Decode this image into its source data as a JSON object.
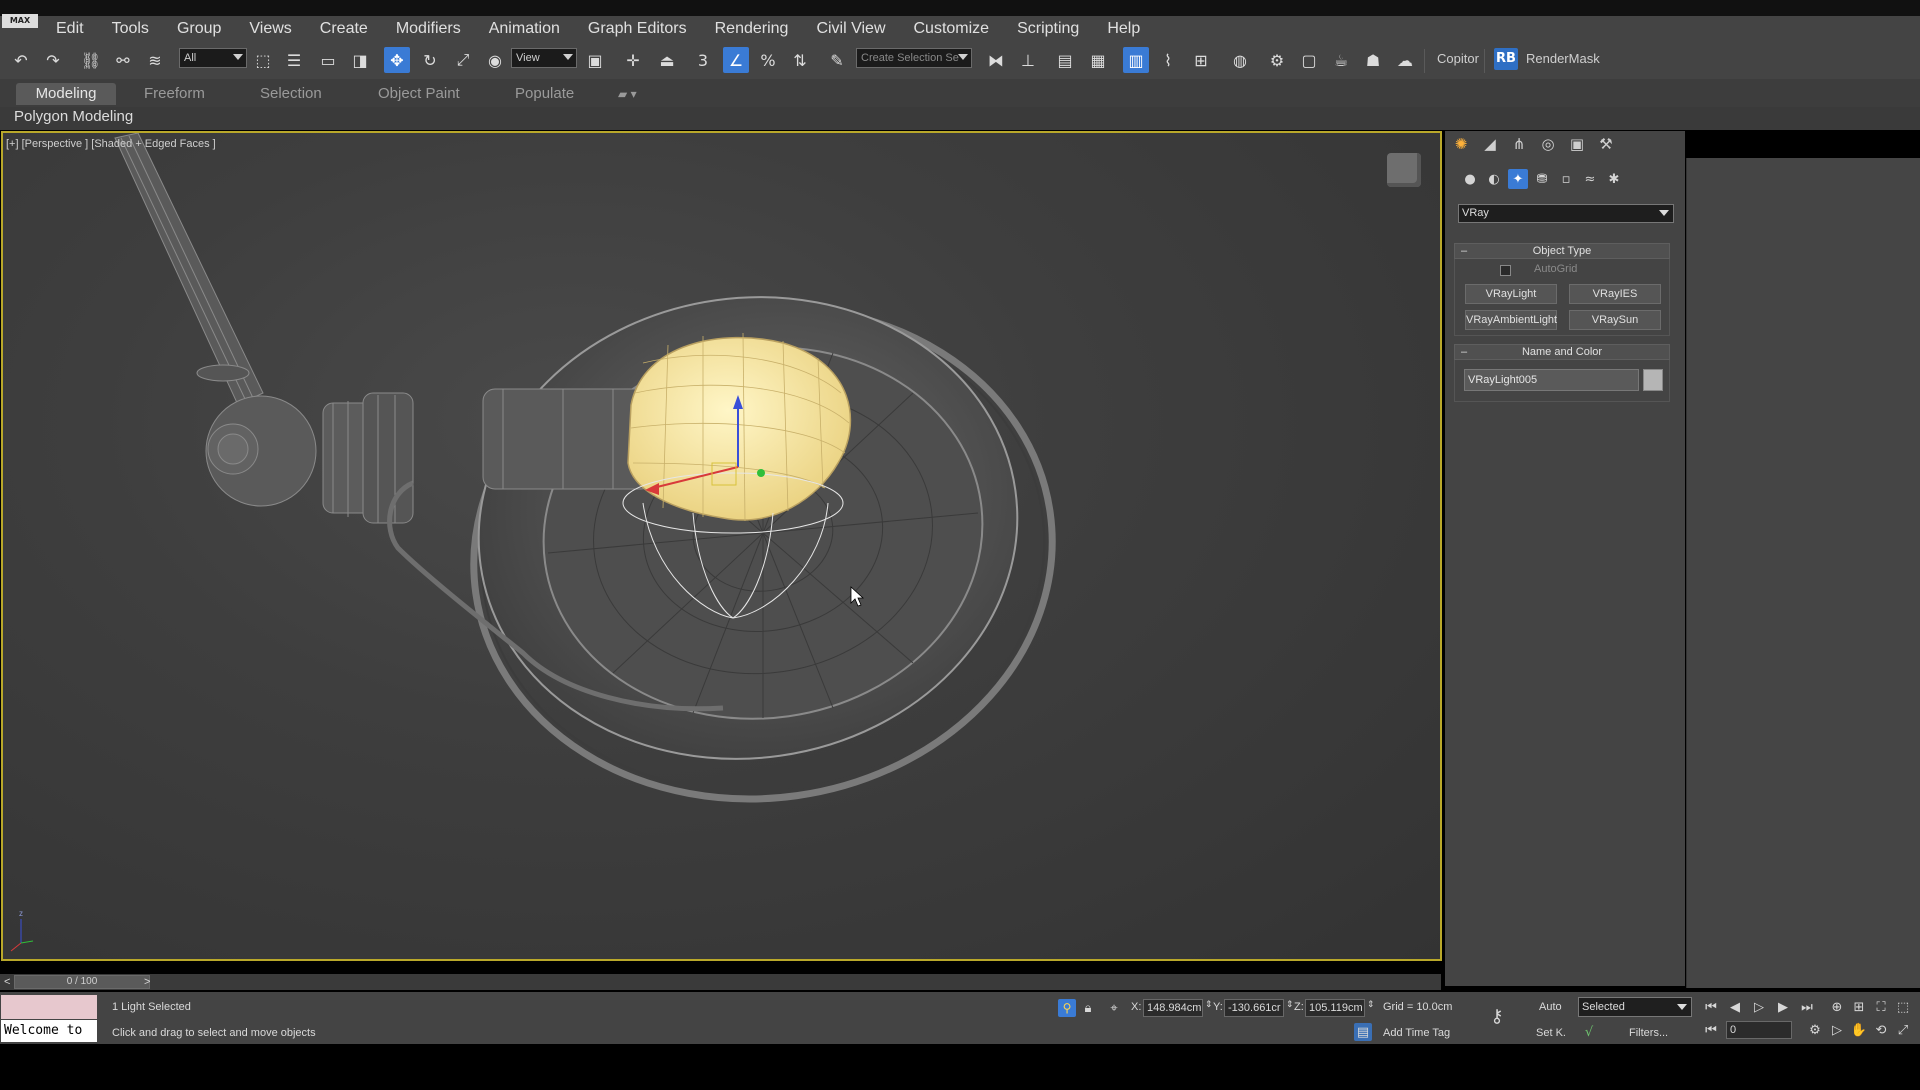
{
  "app": {
    "logo_text": "MAX"
  },
  "menu": [
    "Edit",
    "Tools",
    "Group",
    "Views",
    "Create",
    "Modifiers",
    "Animation",
    "Graph Editors",
    "Rendering",
    "Civil View",
    "Customize",
    "Scripting",
    "Help"
  ],
  "toolbar": {
    "selection_filter": "All",
    "ref_coord": "View",
    "snap_value": "3",
    "named_selection": "Create Selection Se",
    "copitor_label": "Copitor",
    "rb_badge": "RB",
    "rendermask_label": "RenderMask",
    "icons": {
      "undo": "undo-icon",
      "redo": "redo-icon",
      "link": "link-icon",
      "unlink": "unlink-icon",
      "bind_space_warp": "bind-space-warp-icon",
      "select_object": "select-object-icon",
      "select_by_name": "select-by-name-icon",
      "rect_region": "rectangle-region-icon",
      "window_crossing": "window-crossing-icon",
      "move": "move-icon",
      "rotate": "rotate-icon",
      "scale": "scale-icon",
      "place": "place-icon",
      "pivot": "pivot-icon",
      "manipulate": "manipulate-icon",
      "keyboard_shortcut": "keyboard-shortcut-icon",
      "snap": "snap-toggle-icon",
      "angle_snap": "angle-snap-icon",
      "percent_snap": "percent-snap-icon",
      "spinner_snap": "spinner-snap-icon",
      "edit_named_sel": "edit-named-selection-icon",
      "mirror": "mirror-icon",
      "align": "align-icon",
      "layer_explorer": "layer-explorer-icon",
      "scene_explorer": "scene-explorer-icon",
      "ribbon_toggle": "ribbon-toggle-icon",
      "curve_editor": "curve-editor-icon",
      "schematic_view": "schematic-view-icon",
      "material_editor": "material-editor-icon",
      "render_setup": "render-setup-icon",
      "rendered_frame": "rendered-frame-window-icon",
      "render": "render-icon",
      "render_iterative": "render-iterative-icon",
      "render_cloud": "render-cloud-icon",
      "vfb": "vray-frame-buffer-icon"
    }
  },
  "ribbon": {
    "tabs": [
      "Modeling",
      "Freeform",
      "Selection",
      "Object Paint",
      "Populate"
    ],
    "active_tab": "Modeling",
    "sub_label": "Polygon Modeling"
  },
  "viewport": {
    "label": "[+] [Perspective ] [Shaded + Edged Faces ]",
    "border_color": "#b9a82a",
    "bulb_color": "#f6e7a0"
  },
  "command_panel": {
    "tabs": [
      "create-tab-icon",
      "modify-tab-icon",
      "hierarchy-tab-icon",
      "motion-tab-icon",
      "display-tab-icon",
      "utilities-tab-icon"
    ],
    "sub_categories": [
      "geometry-icon",
      "shapes-icon",
      "lights-icon",
      "cameras-icon",
      "helpers-icon",
      "space-warps-icon",
      "systems-icon"
    ],
    "renderer": "VRay",
    "object_type": {
      "title": "Object Type",
      "autogrid_label": "AutoGrid",
      "buttons": [
        "VRayLight",
        "VRayIES",
        "VRayAmbientLight",
        "VRaySun"
      ]
    },
    "name_and_color": {
      "title": "Name and Color",
      "name_value": "VRayLight005",
      "swatch_color": "#b5b5b5"
    }
  },
  "timeline": {
    "frame_display": "0 / 100",
    "prev": "<",
    "next": ">"
  },
  "status": {
    "maxscript_text": "Welcome to",
    "selection_text": "1 Light Selected",
    "prompt_text": "Click and drag to select and move objects",
    "x_label": "X:",
    "x_value": "148.984cm",
    "y_label": "Y:",
    "y_value": "-130.661cr",
    "z_label": "Z:",
    "z_value": "105.119cm",
    "grid_text": "Grid = 10.0cm",
    "add_time_tag": "Add Time Tag",
    "auto_key": "Auto",
    "set_key": "Set K.",
    "key_filter": "Selected",
    "filters": "Filters...",
    "frame_value": "0"
  }
}
